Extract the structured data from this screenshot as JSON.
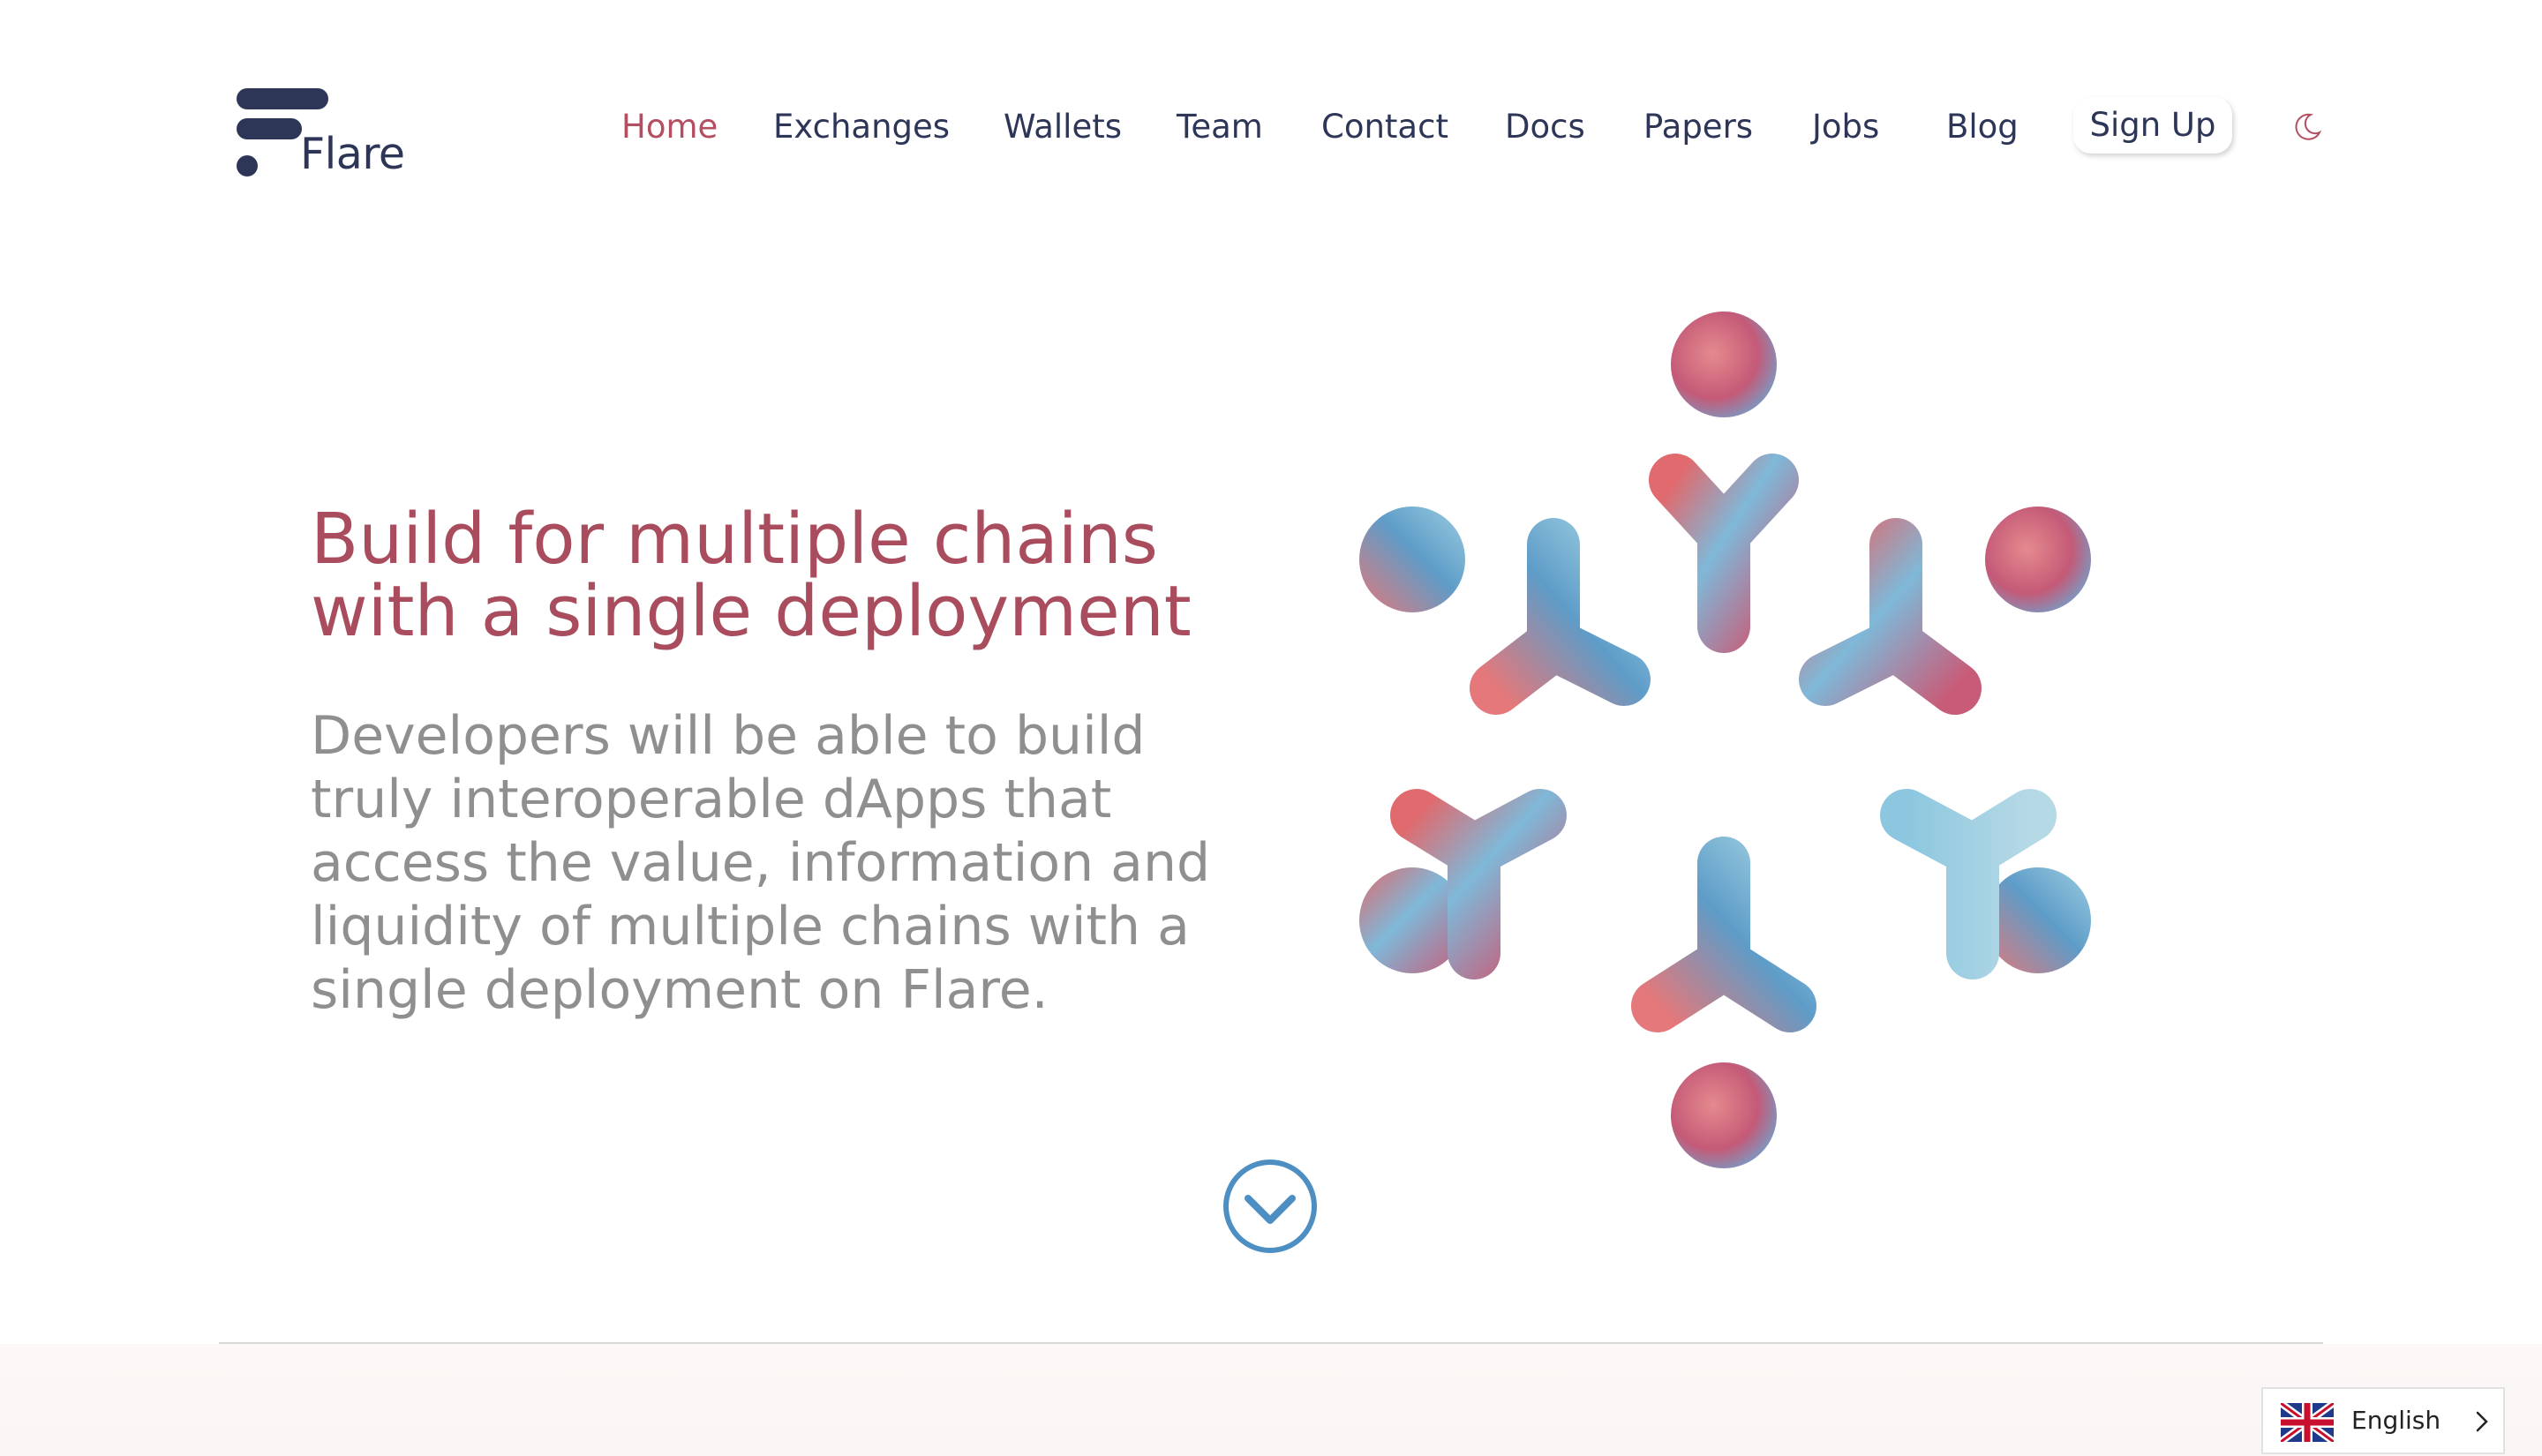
{
  "brand": {
    "name": "Flare",
    "colors": {
      "navy": "#2e3658",
      "rose": "#b44f62",
      "blue": "#4d8fc2",
      "gray": "#8f8f8f"
    }
  },
  "nav": {
    "items": [
      {
        "label": "Home",
        "active": true
      },
      {
        "label": "Exchanges"
      },
      {
        "label": "Wallets"
      },
      {
        "label": "Team"
      },
      {
        "label": "Contact"
      },
      {
        "label": "Docs"
      },
      {
        "label": "Papers"
      },
      {
        "label": "Jobs"
      },
      {
        "label": "Blog"
      }
    ],
    "signup_label": "Sign Up",
    "theme_toggle_icon": "moon-icon"
  },
  "hero": {
    "headline_line1": "Build for multiple chains",
    "headline_line2": "with a single deployment",
    "body": "Developers will be able to build truly interoperable dApps that access the value, information and liquidity of multiple chains with a single deployment on Flare.",
    "scroll_icon": "chevron-down-circle-icon"
  },
  "language": {
    "selected": "English",
    "flag_icon": "uk-flag-icon",
    "chevron_icon": "chevron-right-icon"
  }
}
